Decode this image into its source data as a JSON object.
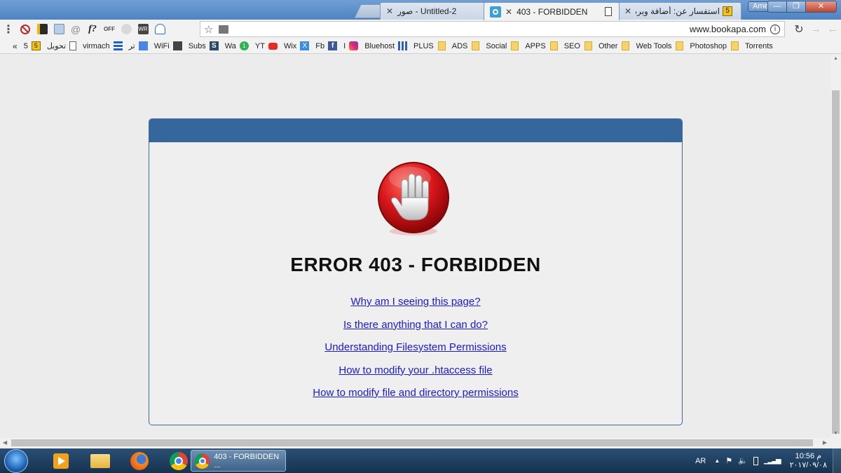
{
  "browser": {
    "tabs": [
      {
        "label": "صور - Untitled-2",
        "active": false
      },
      {
        "label": "403 - FORBIDDEN",
        "active": true
      },
      {
        "label": "استفسار عن: أضافة وبرمجة MP",
        "active": false
      }
    ],
    "user_label": "Amer",
    "window_buttons": {
      "minimize": "—",
      "maximize": "❐",
      "close": "✕"
    },
    "url": "www.bookapa.com",
    "info_icon": "i",
    "colors": {
      "titlebar": "#5b8fc9",
      "card_header": "#35669c",
      "link": "#1a1ad6"
    }
  },
  "bookmarks": [
    {
      "label": "«",
      "type": "overflow"
    },
    {
      "label": "5",
      "icon": "badge-5-icon"
    },
    {
      "label": "تحويل",
      "icon": "page-icon"
    },
    {
      "label": "virmach",
      "icon": "stripes-icon"
    },
    {
      "label": "تر",
      "icon": "translate-icon"
    },
    {
      "label": "WiFi",
      "icon": "wifi-icon"
    },
    {
      "label": "Subs",
      "icon": "s-icon"
    },
    {
      "label": "Wa",
      "icon": "whatsapp-icon"
    },
    {
      "label": "YT",
      "icon": "youtube-icon"
    },
    {
      "label": "Wix",
      "icon": "wix-icon"
    },
    {
      "label": "Fb",
      "icon": "facebook-icon"
    },
    {
      "label": "I",
      "icon": "instagram-icon"
    },
    {
      "label": "Bluehost",
      "icon": "grid-icon"
    },
    {
      "label": "PLUS",
      "icon": "folder-icon"
    },
    {
      "label": "ADS",
      "icon": "folder-icon"
    },
    {
      "label": "Social",
      "icon": "folder-icon"
    },
    {
      "label": "APPS",
      "icon": "folder-icon"
    },
    {
      "label": "SEO",
      "icon": "folder-icon"
    },
    {
      "label": "Other",
      "icon": "folder-icon"
    },
    {
      "label": "Web Tools",
      "icon": "folder-icon"
    },
    {
      "label": "Photoshop",
      "icon": "folder-icon"
    },
    {
      "label": "Torrents",
      "icon": "folder-icon"
    }
  ],
  "page": {
    "title": "ERROR 403 - FORBIDDEN",
    "links": [
      "Why am I seeing this page?",
      "Is there anything that I can do?",
      "Understanding Filesystem Permissions",
      "How to modify your .htaccess file",
      "How to modify file and directory permissions"
    ]
  },
  "taskbar": {
    "active_window": "403 - FORBIDDEN ...",
    "language": "AR",
    "time": "10:56 م",
    "date": "٢٠١٧/٠٩/٠٨"
  }
}
